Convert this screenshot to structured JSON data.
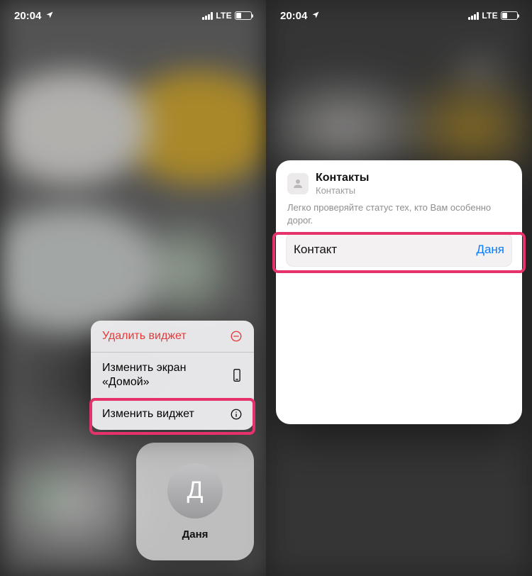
{
  "status": {
    "time": "20:04",
    "network": "LTE"
  },
  "left": {
    "menu": {
      "delete": "Удалить виджет",
      "edit_home": "Изменить экран «Домой»",
      "edit_widget": "Изменить виджет"
    },
    "widget": {
      "initial": "Д",
      "name": "Даня"
    }
  },
  "right": {
    "header": {
      "title": "Контакты",
      "subtitle": "Контакты"
    },
    "description": "Легко проверяйте статус тех, кто Вам особенно дорог.",
    "field": {
      "label": "Контакт",
      "value": "Даня"
    }
  }
}
